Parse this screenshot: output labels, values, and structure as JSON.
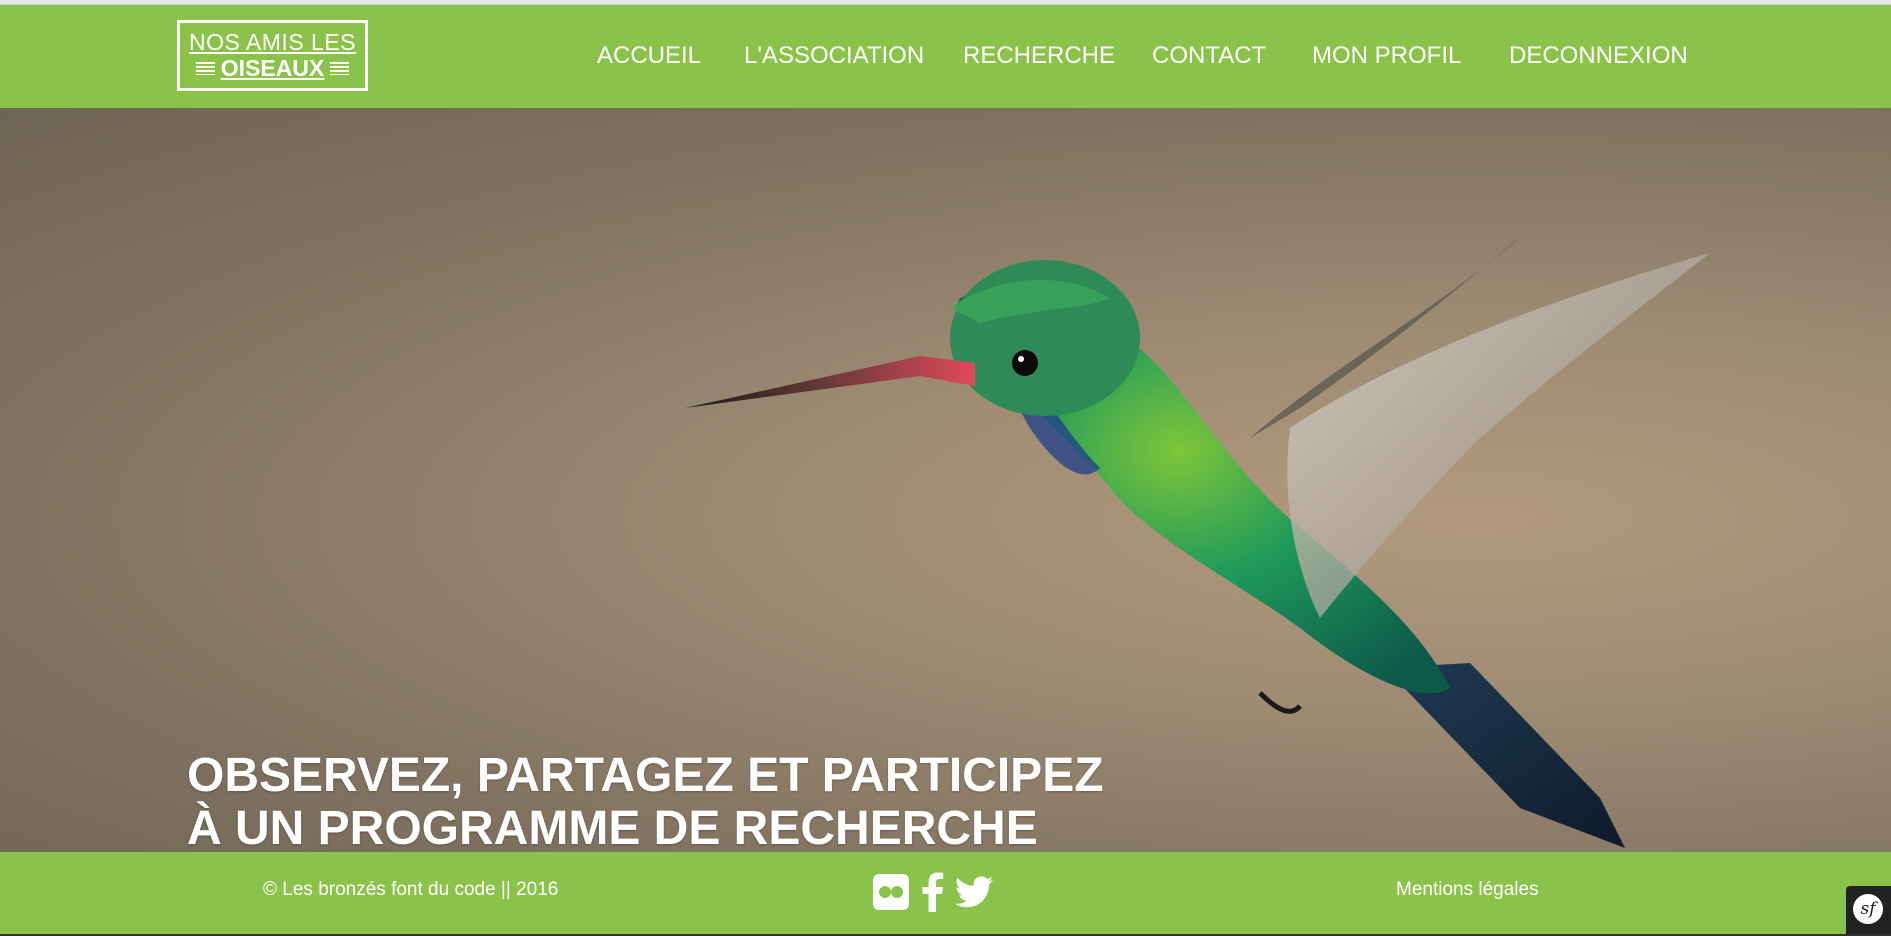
{
  "logo": {
    "line1": "NOS AMIS LES",
    "line2": "OISEAUX"
  },
  "nav": {
    "items": [
      {
        "label": "ACCUEIL"
      },
      {
        "label": "L'ASSOCIATION"
      },
      {
        "label": "RECHERCHE"
      },
      {
        "label": "CONTACT"
      },
      {
        "label": "MON PROFIL"
      },
      {
        "label": "DECONNEXION"
      }
    ]
  },
  "hero": {
    "title_line1": "OBSERVEZ, PARTAGEZ ET PARTICIPEZ",
    "title_line2": "À UN PROGRAMME DE RECHERCHE",
    "image_icon": "hummingbird-photo"
  },
  "footer": {
    "copyright": "© Les bronzés font du code || 2016",
    "legal": "Mentions légales",
    "social": [
      {
        "icon": "flickr-icon"
      },
      {
        "icon": "facebook-icon"
      },
      {
        "icon": "twitter-icon"
      }
    ]
  },
  "debug_toolbar": {
    "label": "sf"
  },
  "colors": {
    "brand_green": "#8bc34a",
    "text_white": "#ffffff"
  }
}
